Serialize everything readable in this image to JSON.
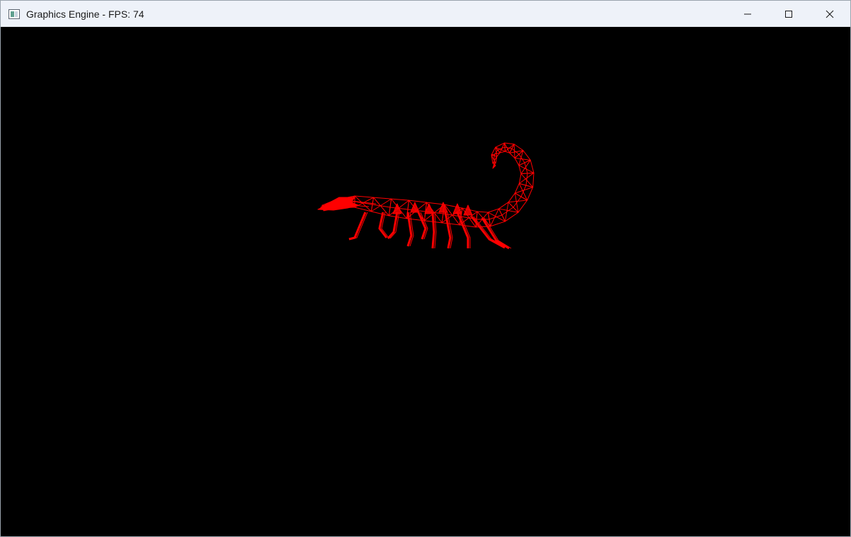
{
  "window": {
    "title": "Graphics Engine - FPS: 74"
  },
  "controls": {
    "minimize_icon": "minimize-icon",
    "maximize_icon": "maximize-icon",
    "close_icon": "close-icon"
  },
  "viewport": {
    "background": "#000000",
    "model": "scorpion",
    "render_mode": "wireframe",
    "wire_color": "#ff0000"
  }
}
